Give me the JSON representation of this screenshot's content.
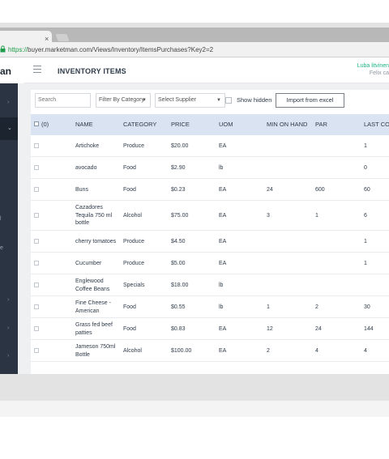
{
  "browser": {
    "tab_close": "×",
    "url_scheme": "https://",
    "url_host": "buyer.marketman.com",
    "url_path": "/Views/Inventory/ItemsPurchases?Key2=2"
  },
  "brand": {
    "partial": "an"
  },
  "header": {
    "title": "INVENTORY ITEMS",
    "user_name": "Luba litvinen",
    "user_sub": "Felix ca"
  },
  "sidebar": {
    "letters": [
      "l",
      "e"
    ]
  },
  "filters": {
    "search_placeholder": "Search",
    "category_label": "Filter By Category",
    "supplier_label": "Select Supplier",
    "show_hidden_label": "Show hidden",
    "import_label": "Import from excel"
  },
  "table": {
    "select_all_count": "(0)",
    "columns": [
      "NAME",
      "CATEGORY",
      "PRICE",
      "UOM",
      "MIN ON HAND",
      "PAR",
      "LAST CO"
    ],
    "rows": [
      {
        "name": [
          "Artichoke"
        ],
        "category": "Produce",
        "price": "$20.00",
        "uom": "EA",
        "min": "",
        "par": "",
        "last": "1"
      },
      {
        "name": [
          "avocado"
        ],
        "category": "Food",
        "price": "$2.90",
        "uom": "lb",
        "min": "",
        "par": "",
        "last": "0"
      },
      {
        "name": [
          "Buns"
        ],
        "category": "Food",
        "price": "$0.23",
        "uom": "EA",
        "min": "24",
        "par": "600",
        "last": "60"
      },
      {
        "name": [
          "Cazadores",
          "Tequila 750 ml",
          "bottle"
        ],
        "category": "Alcohol",
        "price": "$75.00",
        "uom": "EA",
        "min": "3",
        "par": "1",
        "last": "6"
      },
      {
        "name": [
          "cherry tomatoes"
        ],
        "category": "Produce",
        "price": "$4.50",
        "uom": "EA",
        "min": "",
        "par": "",
        "last": "1"
      },
      {
        "name": [
          "Cucumber"
        ],
        "category": "Produce",
        "price": "$5.00",
        "uom": "EA",
        "min": "",
        "par": "",
        "last": "1"
      },
      {
        "name": [
          "Englewood",
          "Coffee Beans"
        ],
        "category": "Specials",
        "price": "$18.00",
        "uom": "lb",
        "min": "",
        "par": "",
        "last": ""
      },
      {
        "name": [
          "Fine Cheese -",
          "American"
        ],
        "category": "Food",
        "price": "$0.55",
        "uom": "lb",
        "min": "1",
        "par": "2",
        "last": "30"
      },
      {
        "name": [
          "Grass fed beef",
          "patties"
        ],
        "category": "Food",
        "price": "$0.83",
        "uom": "EA",
        "min": "12",
        "par": "24",
        "last": "144"
      },
      {
        "name": [
          "Jameson 750ml",
          "Bottle"
        ],
        "category": "Alcohol",
        "price": "$100.00",
        "uom": "EA",
        "min": "2",
        "par": "4",
        "last": "4"
      }
    ]
  },
  "colors": {
    "sidebar": "#2a3442",
    "header_row": "#d9e3f2",
    "user_accent": "#1eb386",
    "secure_green": "#1e9d4a"
  }
}
